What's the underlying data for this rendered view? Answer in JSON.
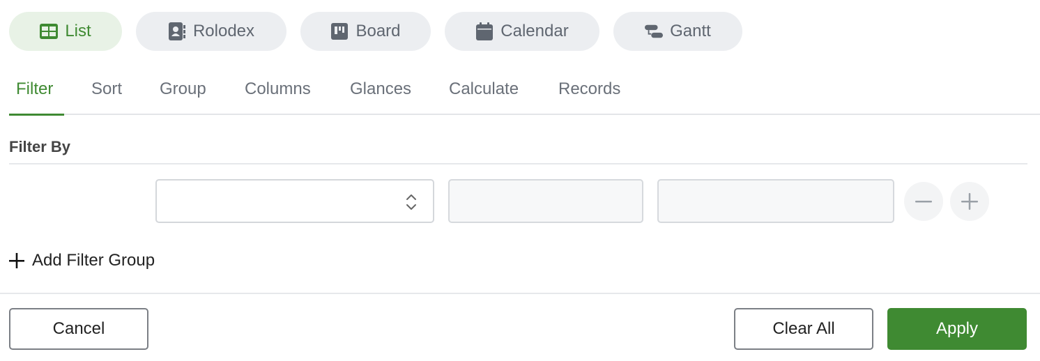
{
  "views": [
    {
      "label": "List",
      "icon": "table-icon",
      "active": true
    },
    {
      "label": "Rolodex",
      "icon": "contact-card-icon",
      "active": false
    },
    {
      "label": "Board",
      "icon": "board-icon",
      "active": false
    },
    {
      "label": "Calendar",
      "icon": "calendar-icon",
      "active": false
    },
    {
      "label": "Gantt",
      "icon": "gantt-icon",
      "active": false
    }
  ],
  "tabs": [
    {
      "label": "Filter",
      "active": true
    },
    {
      "label": "Sort",
      "active": false
    },
    {
      "label": "Group",
      "active": false
    },
    {
      "label": "Columns",
      "active": false
    },
    {
      "label": "Glances",
      "active": false
    },
    {
      "label": "Calculate",
      "active": false
    },
    {
      "label": "Records",
      "active": false
    }
  ],
  "filter": {
    "heading": "Filter By",
    "field_value": "",
    "operator_value": "",
    "value_value": "",
    "add_group_label": "Add Filter Group"
  },
  "footer": {
    "cancel_label": "Cancel",
    "clear_label": "Clear All",
    "apply_label": "Apply"
  },
  "colors": {
    "accent": "#3f8a32",
    "accent_bg": "#e8f2e6",
    "pill_bg": "#eceef1"
  }
}
